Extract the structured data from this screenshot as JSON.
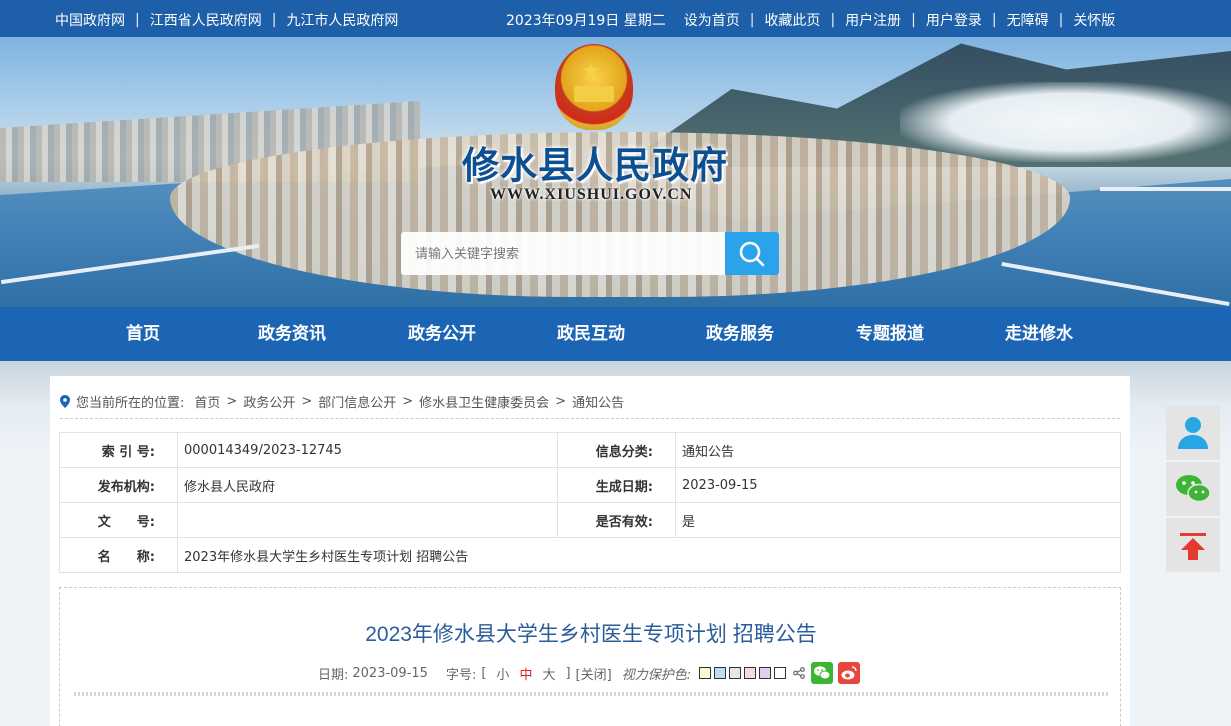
{
  "topbar": {
    "links_left": [
      "中国政府网",
      "江西省人民政府网",
      "九江市人民政府网"
    ],
    "date": "2023年09月19日  星期二",
    "links_right": [
      "设为首页",
      "收藏此页",
      "用户注册",
      "用户登录",
      "无障碍",
      "关怀版"
    ]
  },
  "banner": {
    "title": "修水县人民政府",
    "url": "WWW.XIUSHUI.GOV.CN",
    "search_placeholder": "请输入关键字搜索"
  },
  "nav": [
    "首页",
    "政务资讯",
    "政务公开",
    "政民互动",
    "政务服务",
    "专题报道",
    "走进修水"
  ],
  "breadcrumb": {
    "prefix": "您当前所在的位置:",
    "items": [
      "首页",
      "政务公开",
      "部门信息公开",
      "修水县卫生健康委员会",
      "通知公告"
    ],
    "sep": ">"
  },
  "meta": {
    "index_label": "索 引 号:",
    "index_value": "000014349/2023-12745",
    "category_label": "信息分类:",
    "category_value": "通知公告",
    "publisher_label": "发布机构:",
    "publisher_value": "修水县人民政府",
    "date_label": "生成日期:",
    "date_value": "2023-09-15",
    "docno_label": "文　　号:",
    "docno_value": "",
    "valid_label": "是否有效:",
    "valid_value": "是",
    "name_label": "名　　称:",
    "name_value": "2023年修水县大学生乡村医生专项计划 招聘公告"
  },
  "article": {
    "title": "2023年修水县大学生乡村医生专项计划 招聘公告",
    "date_label": "日期:",
    "date": "2023-09-15",
    "font_label": "字号:",
    "bracket_open": "[",
    "bracket_close": "]",
    "font_small": "小",
    "font_medium": "中",
    "font_large": "大",
    "close": "[关闭]",
    "eye_label": "视力保护色:",
    "swatches": [
      "#fafad2",
      "#b8def0",
      "#e6e6e6",
      "#f5dce4",
      "#e0d0f0",
      "#ffffff"
    ]
  },
  "colors": {
    "primary": "#1c65b4",
    "topbar": "#1d5fa8",
    "search": "#2aa3ea"
  },
  "icons": {
    "location": "location-pin-icon",
    "search": "search-icon",
    "share": "share-icon",
    "wechat": "wechat-icon",
    "weibo": "weibo-icon",
    "user": "user-icon",
    "top": "back-to-top-icon"
  }
}
